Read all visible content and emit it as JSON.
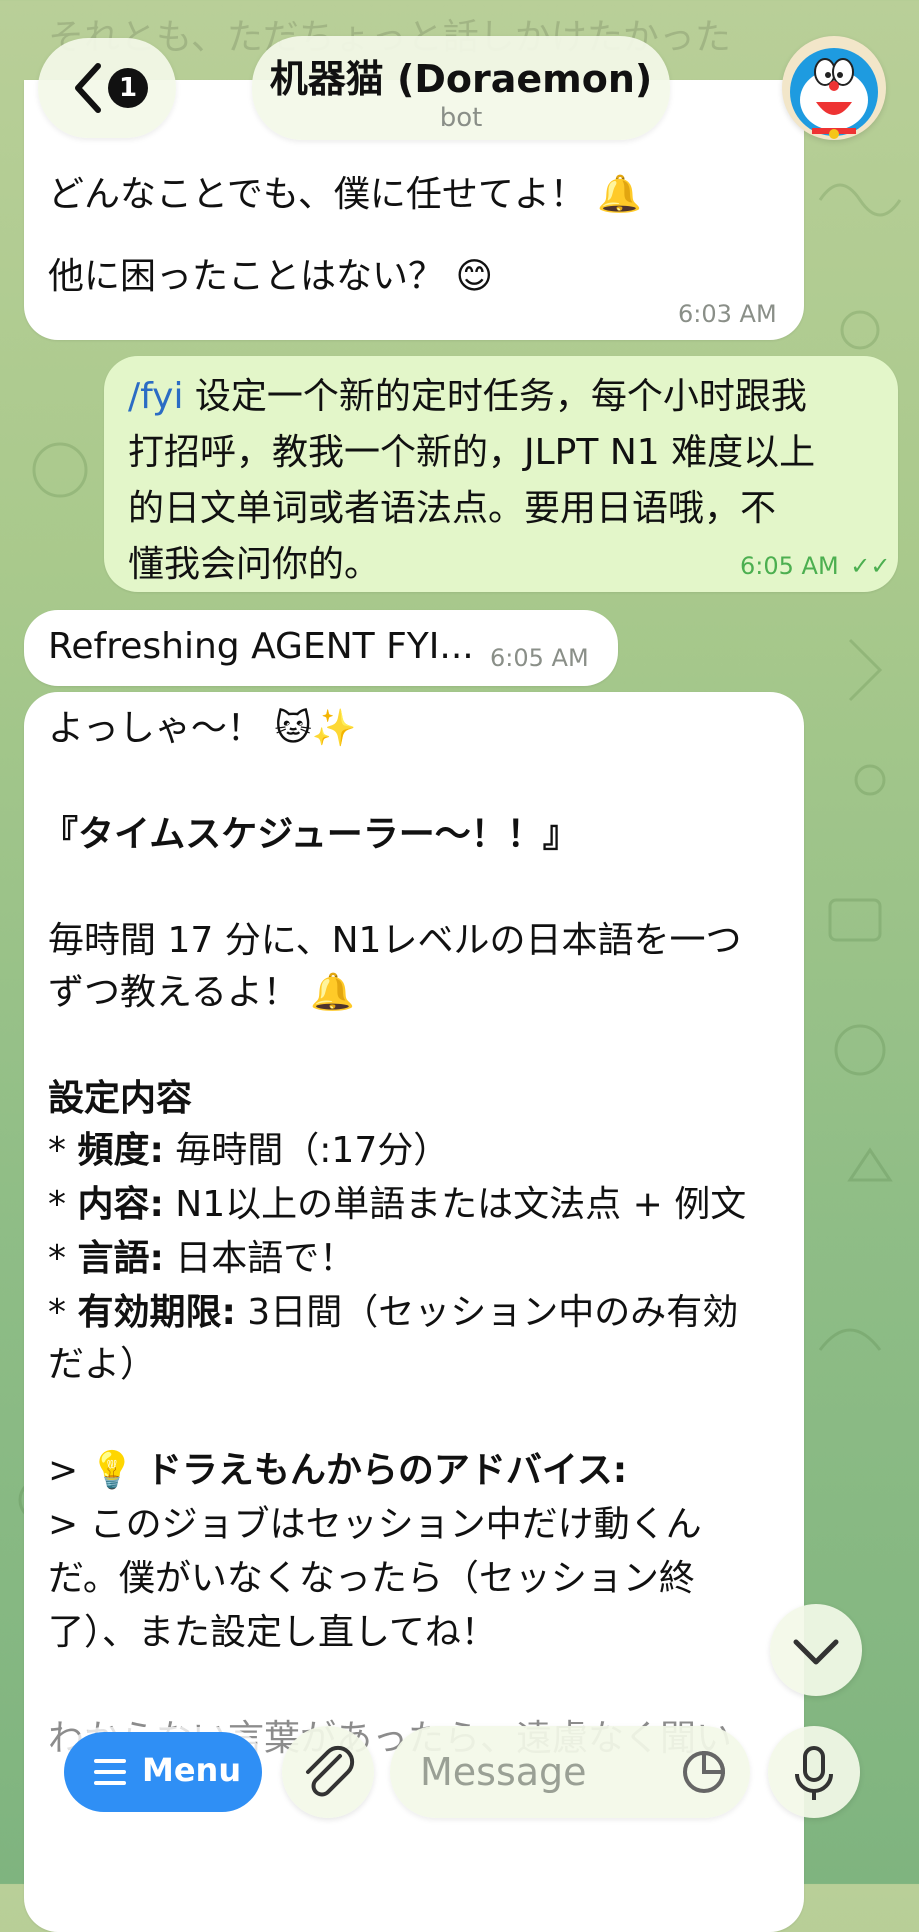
{
  "chat": {
    "title": "机器猫 (Doraemon)",
    "subtitle": "bot",
    "back_badge": "1",
    "avatar_label": "Doraemon avatar"
  },
  "messages": {
    "m1": {
      "top_fragment": "それとも、ただちょっと話しかけたかった",
      "lines": [
        "どんなことでも、僕に任せてよ！ 🔔",
        "他に困ったことはない？ 😊"
      ],
      "time": "6:03 AM"
    },
    "m2": {
      "command": "/fyi",
      "lines": [
        " 设定一个新的定时任务，每个小时跟我",
        "打招呼，教我一个新的，JLPT N1 难度以上",
        "的日文单词或者语法点。要用日语哦，不",
        "懂我会问你的。"
      ],
      "time": "6:05 AM",
      "status": "✓✓"
    },
    "m3": {
      "text": "Refreshing AGENT FYI...",
      "time": "6:05 AM"
    },
    "m4": {
      "greeting": "よっしゃ〜！ 🐱✨",
      "headline": "『タイムスケジューラー〜！！』",
      "intro1": "毎時間 17 分に、N1レベルの日本語を一つ",
      "intro2": "ずつ教えるよ！ 🔔",
      "settings_heading": "設定内容",
      "settings": [
        {
          "label": "頻度:",
          "value": " 毎時間（:17分）"
        },
        {
          "label": "内容:",
          "value": " N1以上の単語または文法点 + 例文"
        },
        {
          "label": "言語:",
          "value": " 日本語で！"
        },
        {
          "label": "有効期限:",
          "value": " 3日間（セッション中のみ有効"
        }
      ],
      "settings_cont": "だよ）",
      "advice_heading": "ドラえもんからのアドバイス:",
      "advice_lines": [
        "> このジョブはセッション中だけ動くん",
        "だ。僕がいなくなったら（セッション終",
        "了）、また設定し直してね！"
      ],
      "bottom_fragment": "わからない言葉があったら、遠慮なく聞い"
    }
  },
  "composer": {
    "menu_label": "Menu",
    "placeholder": "Message"
  }
}
